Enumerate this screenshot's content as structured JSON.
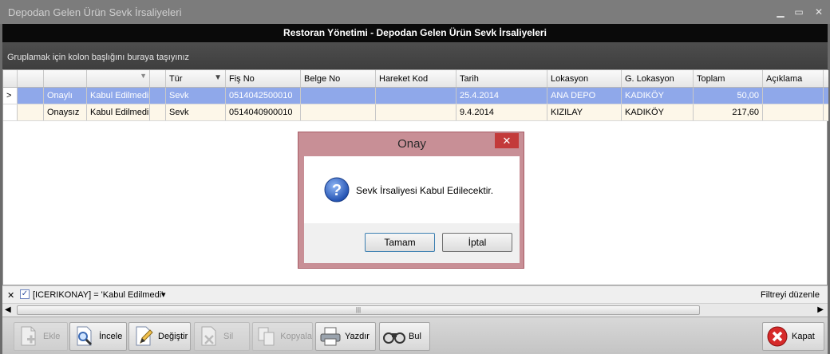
{
  "window": {
    "title": "Depodan Gelen Ürün Sevk İrsaliyeleri",
    "header": "Restoran Yönetimi - Depodan Gelen Ürün Sevk İrsaliyeleri",
    "controls": {
      "minimize": "▁",
      "maximize": "▭",
      "close": "✕"
    }
  },
  "grid": {
    "group_hint": "Gruplamak için kolon başlığını buraya taşıyınız",
    "columns": [
      "",
      "",
      "",
      "",
      "Tür",
      "Fiş No",
      "Belge No",
      "Hareket Kod",
      "Tarih",
      "Lokasyon",
      "G. Lokasyon",
      "Toplam",
      "Açıklama"
    ],
    "rows": [
      {
        "indicator": ">",
        "c1": "",
        "onay": "Onaylı",
        "kabul": "Kabul Edilmedi",
        "blank": "",
        "tur": "Sevk",
        "fis": "0514042500010",
        "belge": "",
        "hareket": "",
        "tarih": "25.4.2014",
        "lokasyon": "ANA DEPO",
        "glokasyon": "KADIKÖY",
        "toplam": "50,00",
        "aciklama": ""
      },
      {
        "indicator": "",
        "c1": "",
        "onay": "Onaysız",
        "kabul": "Kabul Edilmedi",
        "blank": "",
        "tur": "Sevk",
        "fis": "0514040900010",
        "belge": "",
        "hareket": "",
        "tarih": "9.4.2014",
        "lokasyon": "KIZILAY",
        "glokasyon": "KADIKÖY",
        "toplam": "217,60",
        "aciklama": ""
      }
    ]
  },
  "filter": {
    "close": "✕",
    "text": "[ICERIKONAY] = 'Kabul Edilmedi'",
    "dropdown": "▾",
    "edit": "Filtreyi düzenle"
  },
  "scroll": {
    "left": "◀",
    "grip": "|||",
    "right": "▶"
  },
  "toolbar": {
    "ekle": "Ekle",
    "incele": "İncele",
    "degistir": "Değiştir",
    "sil": "Sil",
    "kopyala": "Kopyala",
    "yazdir": "Yazdır",
    "bul": "Bul",
    "kapat": "Kapat"
  },
  "dialog": {
    "title": "Onay",
    "close": "✕",
    "message": "Sevk İrsaliyesi Kabul Edilecektir.",
    "icon": "?",
    "ok": "Tamam",
    "cancel": "İptal"
  },
  "colors": {
    "selected_row": "#8fa8ea",
    "normal_row": "#fdf7e9",
    "dialog_frame": "#c88f96",
    "close_red": "#c33a3a"
  }
}
